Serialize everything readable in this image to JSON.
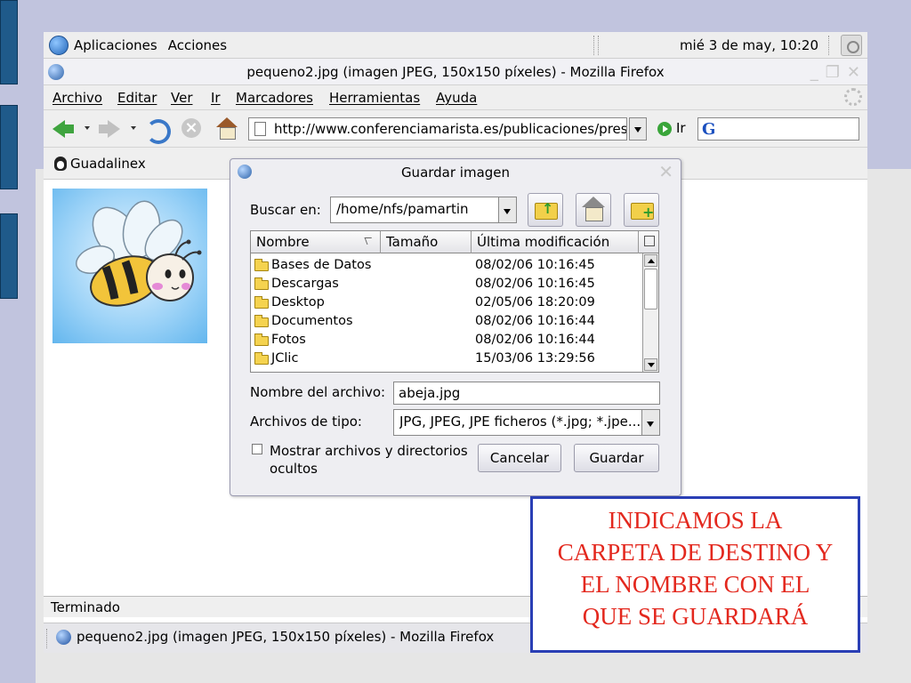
{
  "desktop_panel": {
    "menus": [
      "Aplicaciones",
      "Acciones"
    ],
    "clock": "mié  3 de may, 10:20"
  },
  "window": {
    "title": "pequeno2.jpg (imagen JPEG, 150x150 píxeles) - Mozilla Firefox"
  },
  "menubar": {
    "items": [
      {
        "label": "Archivo"
      },
      {
        "label": "Editar"
      },
      {
        "label": "Ver"
      },
      {
        "label": "Ir"
      },
      {
        "label": "Marcadores"
      },
      {
        "label": "Herramientas"
      },
      {
        "label": "Ayuda"
      }
    ]
  },
  "navbar": {
    "url": "http://www.conferenciamarista.es/publicaciones/presentaciones",
    "go_label": "Ir"
  },
  "bookmarks": {
    "item": "Guadalinex"
  },
  "statusbar": {
    "text": "Terminado"
  },
  "taskbar": {
    "item": "pequeno2.jpg (imagen JPEG, 150x150 píxeles) - Mozilla Firefox"
  },
  "dialog": {
    "title": "Guardar imagen",
    "look_in_label": "Buscar en:",
    "look_in_value": "/home/nfs/pamartin",
    "columns": [
      "Nombre",
      "Tamaño",
      "Última modificación"
    ],
    "files": [
      {
        "name": "Bases de Datos",
        "date": "08/02/06 10:16:45"
      },
      {
        "name": "Descargas",
        "date": "08/02/06 10:16:45"
      },
      {
        "name": "Desktop",
        "date": "02/05/06 18:20:09"
      },
      {
        "name": "Documentos",
        "date": "08/02/06 10:16:44"
      },
      {
        "name": "Fotos",
        "date": "08/02/06 10:16:44"
      },
      {
        "name": "JClic",
        "date": "15/03/06 13:29:56"
      }
    ],
    "filename_label": "Nombre del archivo:",
    "filename_value": "abeja.jpg",
    "filetype_label": "Archivos de tipo:",
    "filetype_value": "JPG, JPEG, JPE ficheros (*.jpg; *.jpe...",
    "show_hidden_line1": "Mostrar archivos y directorios",
    "show_hidden_line2": "ocultos",
    "cancel_label": "Cancelar",
    "save_label": "Guardar"
  },
  "callout": {
    "lines": [
      "INDICAMOS LA",
      "CARPETA DE DESTINO Y",
      "EL NOMBRE CON EL",
      "QUE SE GUARDARÁ"
    ]
  }
}
